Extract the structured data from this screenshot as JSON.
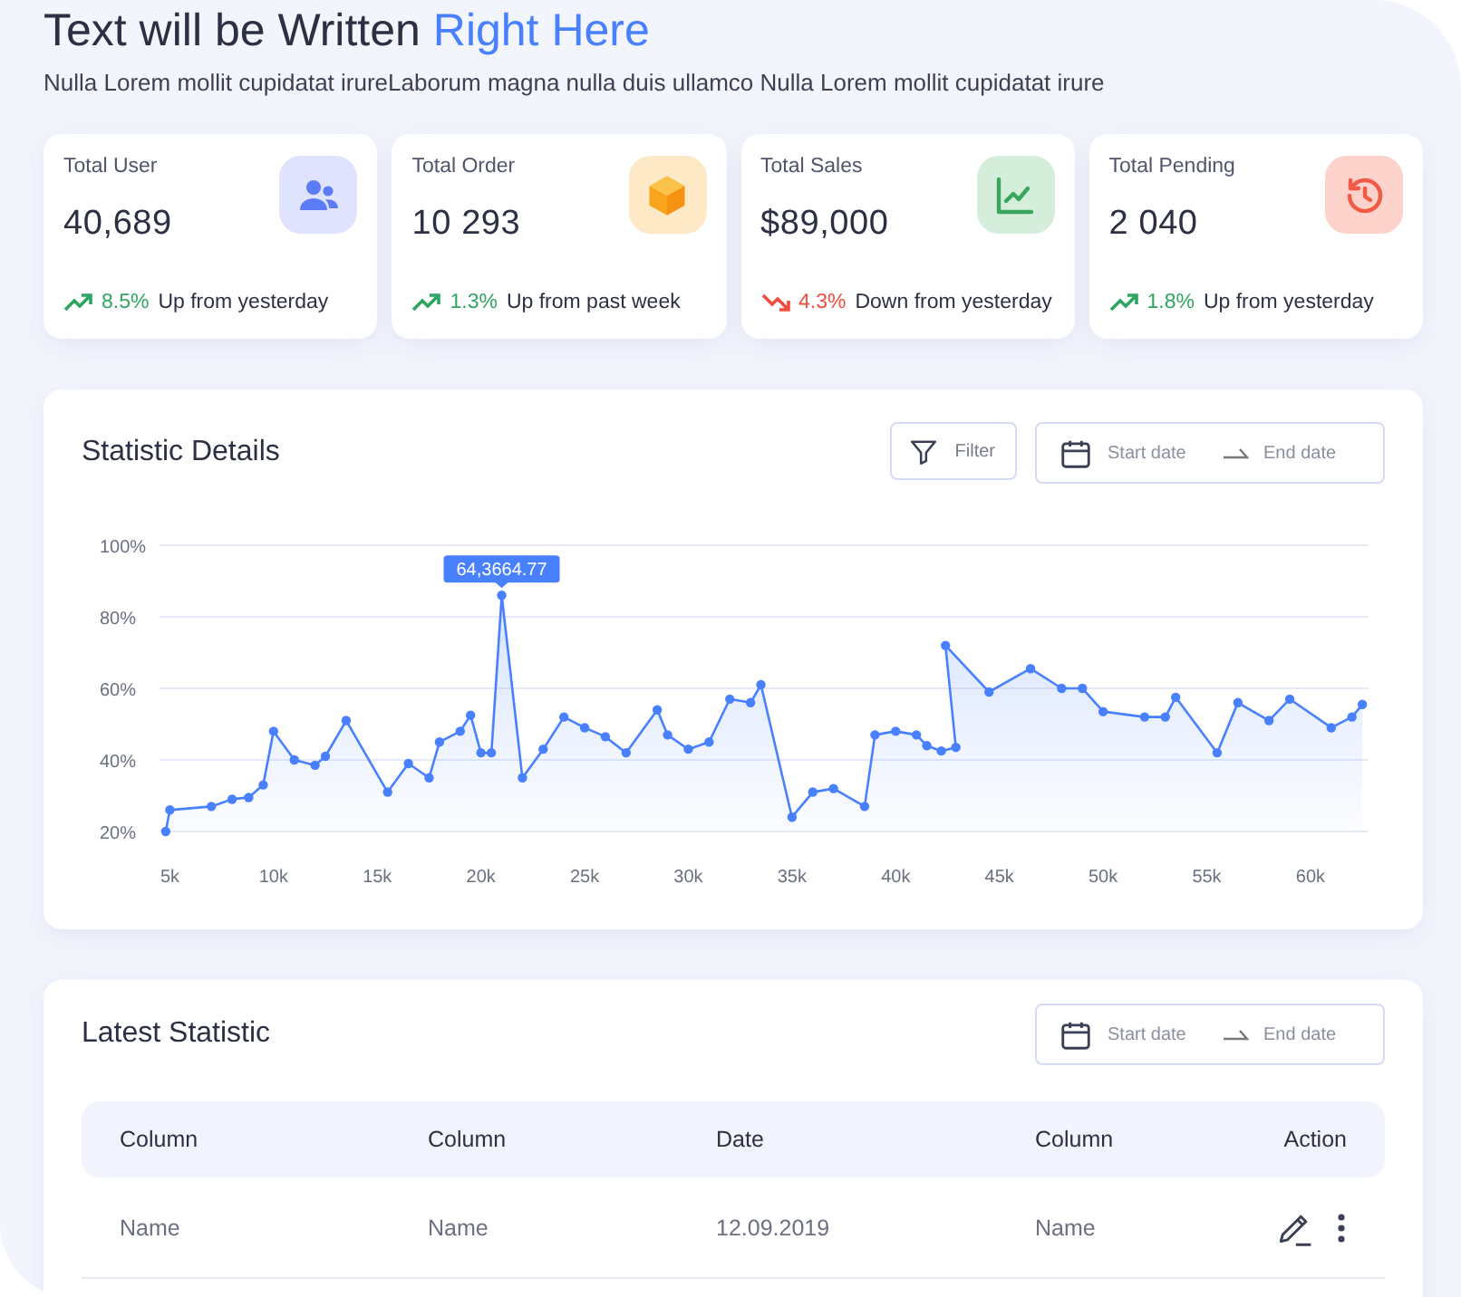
{
  "header": {
    "title": "Text will be Written **Right Here**",
    "subtitle": "Nulla Lorem mollit cupidatat irureLaborum magna nulla duis ullamco Nulla Lorem mollit cupidatat irure"
  },
  "stat_cards": [
    {
      "label": "Total User",
      "value": "40,689",
      "kind": "users",
      "color": "#dfe3fd",
      "change": {
        "kind": "up",
        "percent": "8.5%",
        "note": "Up from yesterday"
      }
    },
    {
      "label": "Total Order",
      "value": "10 293",
      "kind": "box",
      "color": "#fde9c6",
      "change": {
        "kind": "up",
        "percent": "1.3%",
        "note": "Up from past week"
      }
    },
    {
      "label": "Total Sales",
      "value": "$89,000",
      "kind": "chart",
      "color": "#d5eedb",
      "change": {
        "kind": "down",
        "percent": "4.3%",
        "note": "Down from yesterday"
      }
    },
    {
      "label": "Total Pending",
      "value": "2 040",
      "kind": "history",
      "color": "#fdd2cb",
      "change": {
        "kind": "up",
        "percent": "1.8%",
        "note": "Up from yesterday"
      }
    }
  ],
  "statistic_details": {
    "title": "Statistic Details",
    "filter_button": "Filter",
    "date_range": {
      "start_placeholder": "Start date",
      "end_placeholder": "End date"
    },
    "chart_data": {
      "type": "area",
      "grid": true,
      "xlim": [
        4.5,
        62.8
      ],
      "ylim": [
        20,
        100
      ],
      "xticks": [
        {
          "value": 5,
          "label": "5k"
        },
        {
          "value": 10,
          "label": "10k"
        },
        {
          "value": 15,
          "label": "15k"
        },
        {
          "value": 20,
          "label": "20k"
        },
        {
          "value": 25,
          "label": "25k"
        },
        {
          "value": 30,
          "label": "30k"
        },
        {
          "value": 35,
          "label": "35k"
        },
        {
          "value": 40,
          "label": "40k"
        },
        {
          "value": 45,
          "label": "45k"
        },
        {
          "value": 50,
          "label": "50k"
        },
        {
          "value": 55,
          "label": "55k"
        },
        {
          "value": 60,
          "label": "60k"
        }
      ],
      "yticks": [
        {
          "value": 20,
          "label": "20%"
        },
        {
          "value": 40,
          "label": "40%"
        },
        {
          "value": 60,
          "label": "60%"
        },
        {
          "value": 80,
          "label": "80%"
        },
        {
          "value": 100,
          "label": "100%"
        }
      ],
      "x": [
        4.8,
        5,
        7,
        8,
        8.8,
        9.5,
        10,
        11,
        12,
        12.5,
        13.5,
        15.5,
        16.5,
        17.5,
        18,
        19,
        19.5,
        20,
        20.5,
        21,
        22,
        23,
        24,
        25,
        26,
        27,
        28.5,
        29,
        30,
        31,
        32,
        33,
        33.5,
        35,
        36,
        37,
        38.5,
        39,
        40,
        41,
        41.5,
        42.2,
        42.9,
        42.4,
        44.5,
        46.5,
        48,
        49,
        50,
        52,
        53,
        53.5,
        55.5,
        56.5,
        58,
        59,
        61,
        62,
        62.5
      ],
      "series": [
        {
          "color": "#4880ff",
          "values": [
            20,
            26,
            27,
            29,
            29.5,
            33,
            48,
            40,
            38.5,
            41,
            51,
            31,
            39,
            35,
            45,
            48,
            52.5,
            42,
            42,
            86,
            35,
            43,
            52,
            49,
            46.5,
            42,
            54,
            47,
            43,
            45,
            57,
            56,
            61,
            24,
            31,
            32,
            27,
            47,
            48,
            47,
            44,
            42.5,
            43.5,
            72,
            59,
            65.5,
            60,
            60,
            53.5,
            52,
            52,
            57.5,
            42,
            56,
            51,
            57,
            49,
            52,
            55.5
          ]
        }
      ],
      "annotations": [
        {
          "text": "64,3664.77"
        }
      ]
    }
  },
  "latest_statistic": {
    "title": "Latest Statistic",
    "date_range": {
      "start_placeholder": "Start date",
      "end_placeholder": "End date"
    },
    "table": {
      "columns": [
        "Column",
        "Column",
        "Date",
        "Column",
        "Action"
      ],
      "rows": [
        {
          "cells": [
            "Name",
            "Name",
            "12.09.2019",
            "Name"
          ]
        }
      ]
    }
  }
}
